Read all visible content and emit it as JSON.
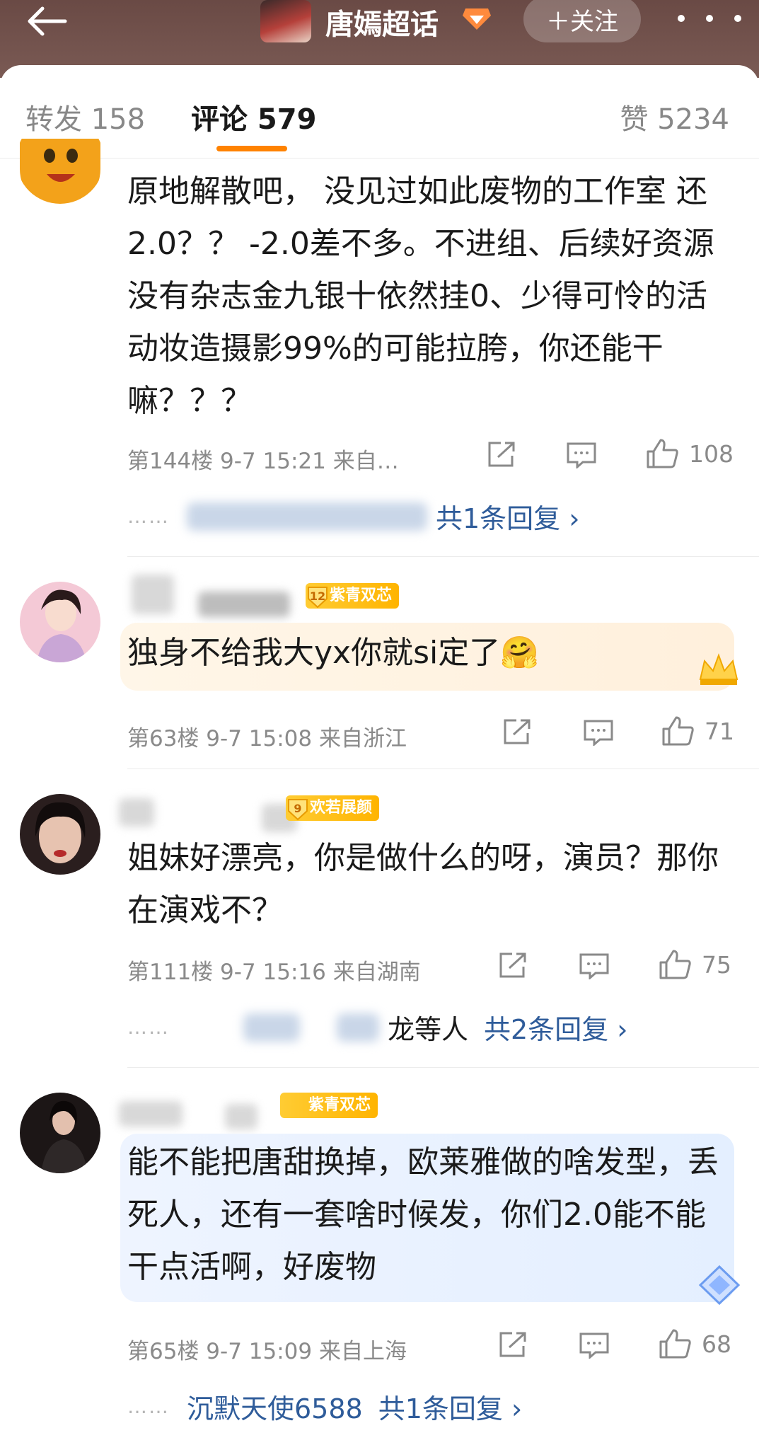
{
  "header": {
    "title": "唐嫣超话",
    "follow_label": "＋关注"
  },
  "tabs": {
    "forward": "转发 158",
    "comments": "评论 579",
    "likes": "赞 5234"
  },
  "comments": [
    {
      "text": "原地解散吧， 没见过如此废物的工作室 还2.0？？ -2.0差不多。不进组、后续好资源没有杂志金九银十依然挂0、少得可怜的活动妆造摄影99%的可能拉胯，你还能干嘛？？？",
      "meta": "第144楼  9-7 15:21  来自…",
      "likes": "108",
      "reply_label": "共1条回复 ›"
    },
    {
      "badge_level": "12",
      "badge": "紫青双芯",
      "text": "独身不给我大yx你就si定了🤗",
      "meta": "第63楼  9-7 15:08  来自浙江",
      "likes": "71"
    },
    {
      "badge_level": "9",
      "badge": "欢若展颜",
      "text": "姐妹好漂亮，你是做什么的呀，演员？那你在演戏不？",
      "meta": "第111楼  9-7 15:16  来自湖南",
      "likes": "75",
      "reply_partial": "龙等人",
      "reply_label": "共2条回复 ›"
    },
    {
      "badge": "紫青双芯",
      "text": "能不能把唐甜换掉，欧莱雅做的啥发型，丢死人，还有一套啥时候发，你们2.0能不能干点活啊，好废物",
      "meta": "第65楼  9-7 15:09  来自上海",
      "likes": "68",
      "reply_user": "沉默天使6588",
      "reply_label": "共1条回复 ›"
    }
  ],
  "colors": {
    "accent": "#ff8200",
    "link": "#2f5c9a",
    "header_bg": "#6a4a45"
  },
  "icons": [
    "back-arrow-icon",
    "super-topic-badge-icon",
    "more-icon",
    "share-icon",
    "comment-icon",
    "like-icon",
    "chevron-right-icon"
  ]
}
